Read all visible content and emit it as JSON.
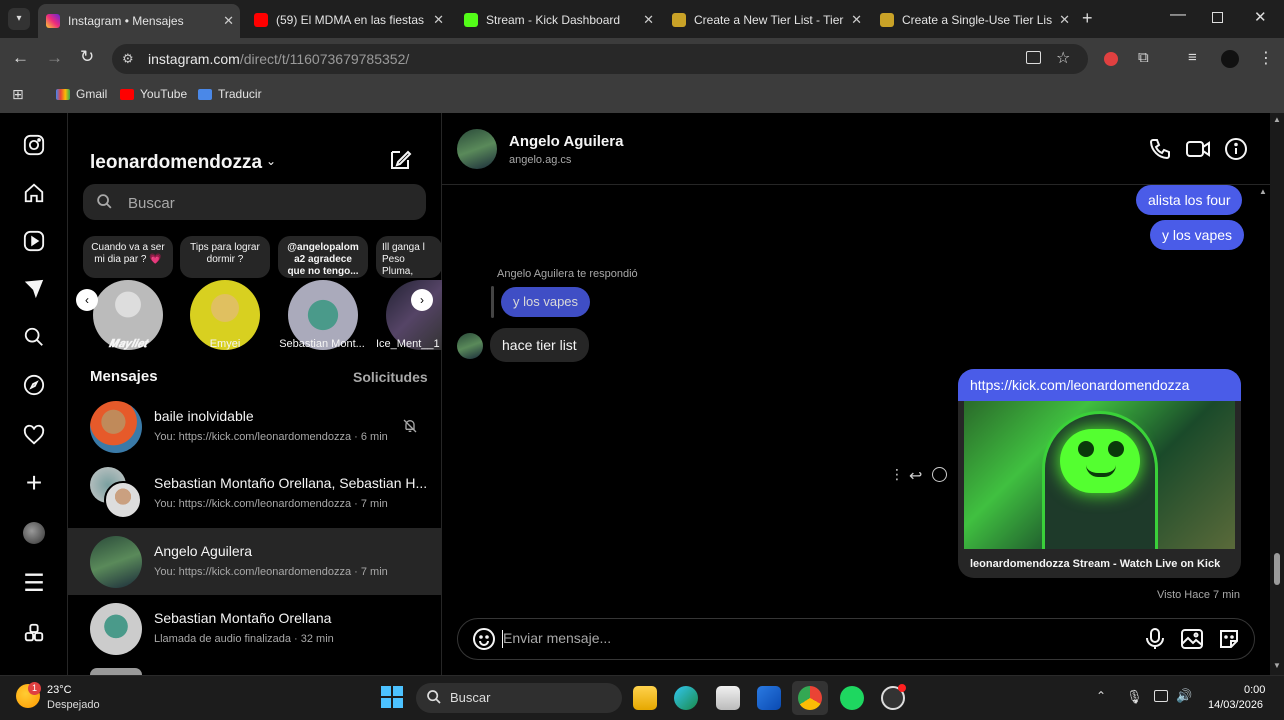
{
  "browser": {
    "tabs": [
      {
        "title": "Instagram • Mensajes",
        "color": "#e1306c"
      },
      {
        "title": "(59) El MDMA en las fiestas",
        "color": "#ff0000"
      },
      {
        "title": "Stream - Kick Dashboard",
        "color": "#53fc18"
      },
      {
        "title": "Create a New Tier List - Tier",
        "color": "#c9a227"
      },
      {
        "title": "Create a Single-Use Tier List",
        "color": "#c9a227"
      }
    ],
    "url_main": "instagram.com",
    "url_path": "/direct/t/116073679785352/",
    "bookmarks": [
      "Gmail",
      "YouTube",
      "Traducir"
    ]
  },
  "inbox": {
    "username": "leonardomendozza",
    "search_placeholder": "Buscar",
    "notes": [
      "Cuando va a ser mi dia par ? 💗",
      "Tips para lograr dormir ?",
      "@angelopalom a2 agradece que no tengo...",
      "Ill ganga l Peso Pluma,"
    ],
    "stories": [
      "𝑴𝒂𝒚𝒍𝒊𝒆𝒕",
      "Emyei",
      "Sebastian Mont...",
      "Ice_Ment__1"
    ],
    "messages_label": "Mensajes",
    "requests_label": "Solicitudes",
    "conversations": [
      {
        "name": "baile inolvidable",
        "preview": "You: https://kick.com/leonardomendozza · 6 min"
      },
      {
        "name": "Sebastian Montaño Orellana, Sebastian H...",
        "preview": "You: https://kick.com/leonardomendozza · 7 min"
      },
      {
        "name": "Angelo Aguilera",
        "preview": "You: https://kick.com/leonardomendozza · 7 min"
      },
      {
        "name": "Sebastian Montaño Orellana",
        "preview": "Llamada de audio finalizada · 32 min"
      }
    ]
  },
  "chat": {
    "name": "Angelo Aguilera",
    "handle": "angelo.ag.cs",
    "messages": {
      "m1": "alista los four",
      "m2": "y los vapes",
      "reply_label": "Angelo Aguilera te respondió",
      "quoted": "y los vapes",
      "their_msg": "hace tier list",
      "link": "https://kick.com/leonardomendozza",
      "card_title": "leonardomendozza Stream - Watch Live on Kick"
    },
    "seen": "Visto Hace 7 min",
    "composer_placeholder": "Enviar mensaje..."
  },
  "taskbar": {
    "weather_temp": "23°C",
    "weather_desc": "Despejado",
    "weather_badge": "1",
    "search": "Buscar",
    "time": "0:00",
    "date": "14/03/2026"
  }
}
